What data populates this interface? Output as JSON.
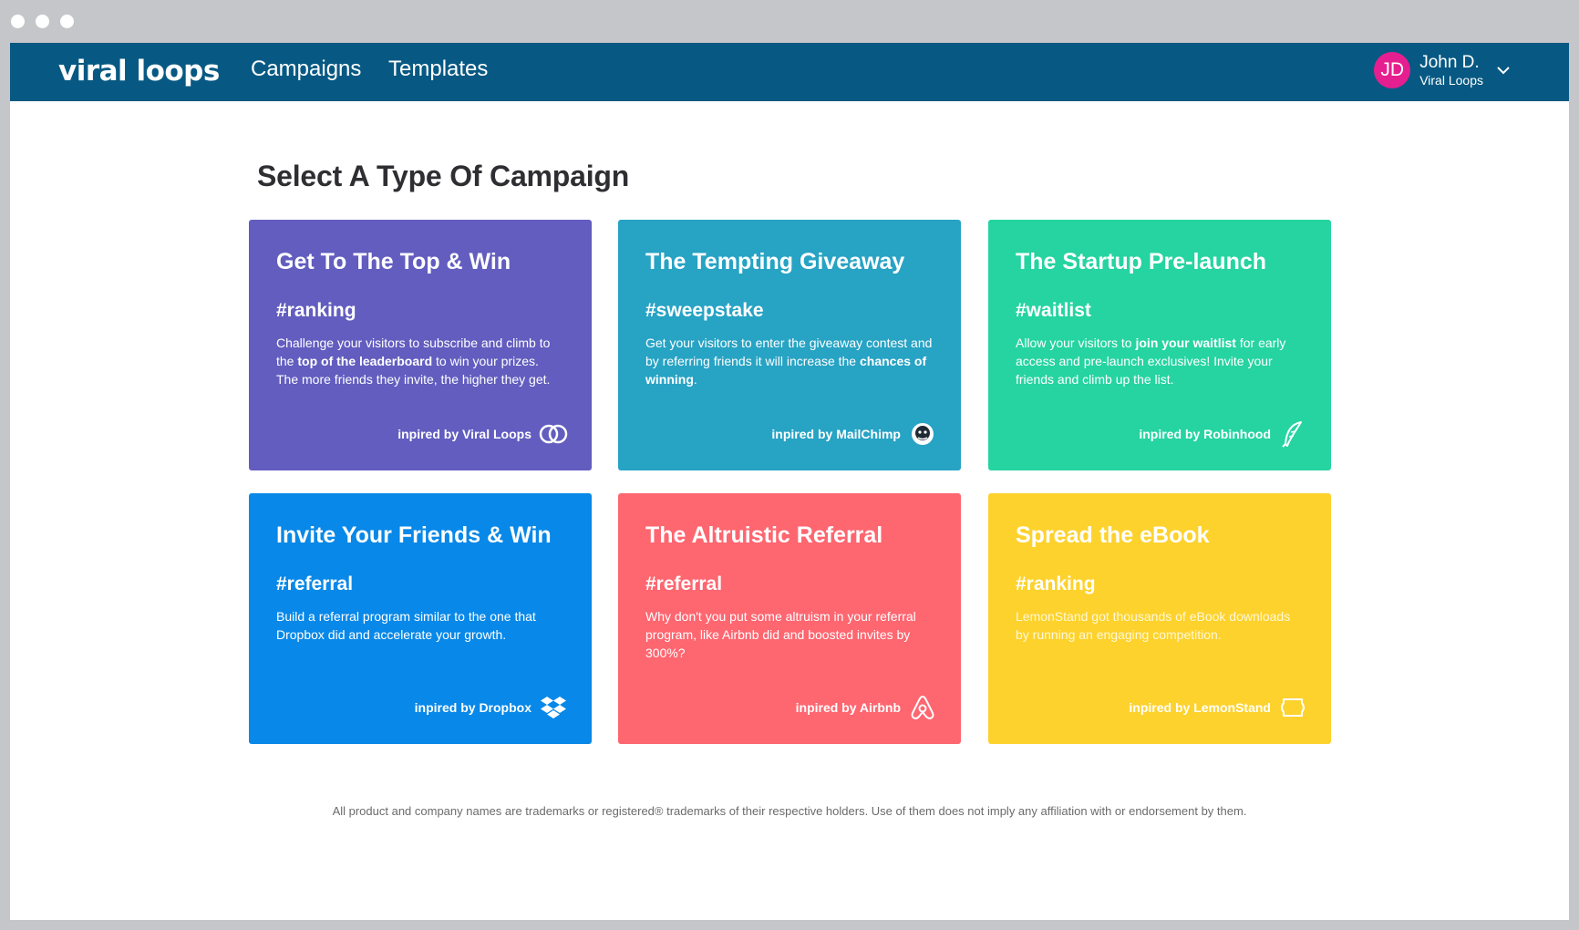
{
  "nav": {
    "logo": "viral loops",
    "links": [
      "Campaigns",
      "Templates"
    ]
  },
  "user": {
    "initials": "JD",
    "name": "John D.",
    "org": "Viral Loops"
  },
  "page": {
    "heading": "Select A Type Of Campaign",
    "disclaimer": "All product and company names are trademarks or registered® trademarks of their respective holders. Use of them does not imply any affiliation with or endorsement by them."
  },
  "cards": [
    {
      "title": "Get To The Top & Win",
      "tag": "#ranking",
      "desc": [
        "Challenge your visitors to subscribe and climb to the ",
        "top of the leaderboard",
        " to win your prizes. The more friends they invite, the higher they get."
      ],
      "inspired": "inpired by Viral Loops",
      "icon": "viral-loops-icon",
      "color": "#625dbf"
    },
    {
      "title": "The Tempting Giveaway",
      "tag": "#sweepstake",
      "desc": [
        "Get your visitors to enter the giveaway contest and by referring friends it will increase the ",
        "chances of winning",
        "."
      ],
      "inspired": "inpired by MailChimp",
      "icon": "mailchimp-icon",
      "color": "#27a3c4"
    },
    {
      "title": "The Startup Pre-launch",
      "tag": "#waitlist",
      "desc": [
        "Allow your visitors to ",
        "join your waitlist",
        " for early access and pre-launch exclusives! Invite your friends and climb up the list."
      ],
      "inspired": "inpired by Robinhood",
      "icon": "feather-icon",
      "color": "#25d4a1"
    },
    {
      "title": "Invite Your Friends & Win",
      "tag": "#referral",
      "desc": [
        "Build a referral program similar to the one that Dropbox did and accelerate your growth.",
        "",
        ""
      ],
      "inspired": "inpired by Dropbox",
      "icon": "dropbox-icon",
      "color": "#0888e8"
    },
    {
      "title": "The Altruistic Referral",
      "tag": "#referral",
      "desc": [
        "Why don't you put some altruism in your referral program, like Airbnb did and boosted invites by 300%?",
        "",
        ""
      ],
      "inspired": "inpired by Airbnb",
      "icon": "airbnb-icon",
      "color": "#fe6670"
    },
    {
      "title": "Spread the eBook",
      "tag": "#ranking",
      "desc": [
        "LemonStand got thousands of eBook downloads by running an engaging competition.",
        "",
        ""
      ],
      "inspired": "inpired by LemonStand",
      "icon": "lemonstand-icon",
      "color": "#fdd22d"
    }
  ]
}
